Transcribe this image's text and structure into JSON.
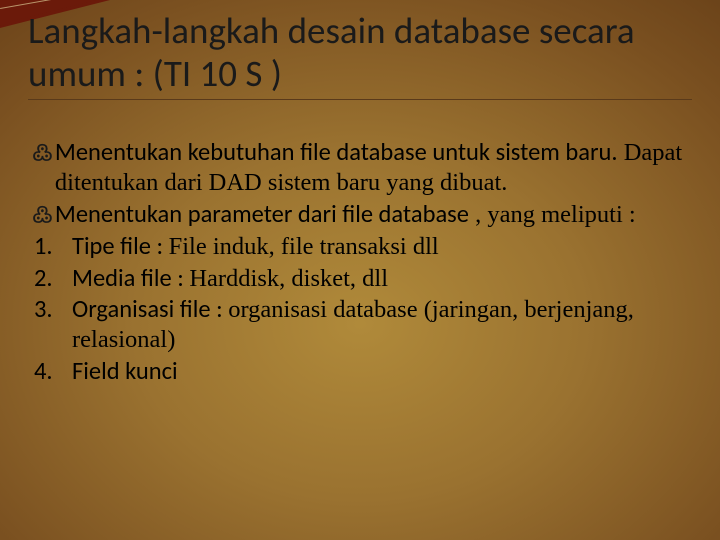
{
  "title": "Langkah-langkah desain database secara umum : (TI 10 S )",
  "bullets": [
    {
      "prefix_sans": "Menentukan kebutuhan file database untuk sistem baru.",
      "suffix_serif": "  Dapat ditentukan dari DAD sistem baru yang dibuat."
    },
    {
      "prefix_sans": "Menentukan parameter dari file database",
      "suffix_serif": " , yang meliputi :"
    }
  ],
  "numbered": [
    {
      "n": "1.",
      "sans": "Tipe file : ",
      "serif": "File induk, file transaksi dll"
    },
    {
      "n": "2.",
      "sans": "Media file : ",
      "serif": "Harddisk, disket, dll"
    },
    {
      "n": "3.",
      "sans": "Organisasi file : ",
      "serif": "organisasi database (jaringan, berjenjang, relasional)"
    },
    {
      "n": "4.",
      "sans": "Field kunci",
      "serif": ""
    }
  ],
  "bullet_glyph": "߷"
}
